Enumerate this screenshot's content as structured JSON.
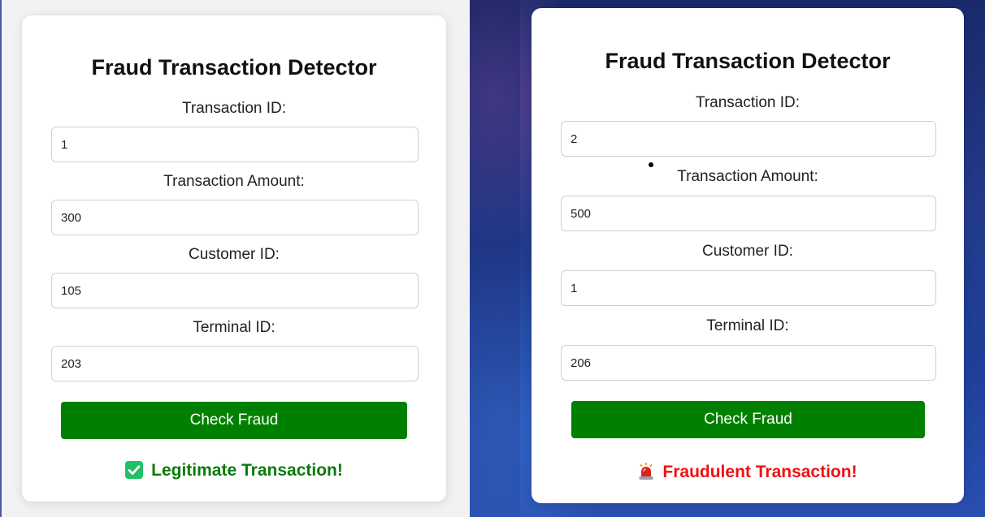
{
  "left_form": {
    "title": "Fraud Transaction Detector",
    "fields": [
      {
        "label": "Transaction ID:",
        "value": "1"
      },
      {
        "label": "Transaction Amount:",
        "value": "300"
      },
      {
        "label": "Customer ID:",
        "value": "105"
      },
      {
        "label": "Terminal ID:",
        "value": "203"
      }
    ],
    "button_label": "Check Fraud",
    "result_text": "Legitimate Transaction!",
    "result_icon": "check-mark-icon",
    "result_color": "#0b7a0b"
  },
  "right_form": {
    "title": "Fraud Transaction Detector",
    "fields": [
      {
        "label": "Transaction ID:",
        "value": "2"
      },
      {
        "label": "Transaction Amount:",
        "value": "500"
      },
      {
        "label": "Customer ID:",
        "value": "1"
      },
      {
        "label": "Terminal ID:",
        "value": "206"
      }
    ],
    "button_label": "Check Fraud",
    "result_text": "Fraudulent Transaction!",
    "result_icon": "siren-icon",
    "result_color": "#ee1111"
  },
  "colors": {
    "button": "#008000",
    "legit_badge": "#22c064"
  }
}
